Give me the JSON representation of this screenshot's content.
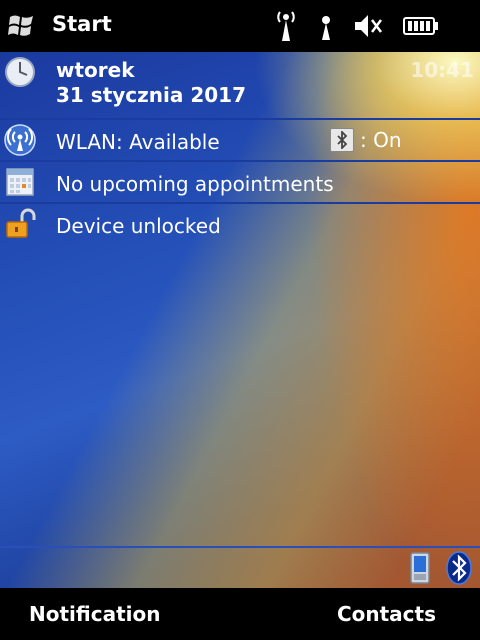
{
  "titlebar": {
    "title": "Start",
    "icons": [
      "windows-logo-icon",
      "wireless-antenna-icon",
      "signal-icon",
      "speaker-muted-icon",
      "battery-icon"
    ]
  },
  "today": {
    "day": "wtorek",
    "date": "31 stycznia 2017",
    "time": "10:41",
    "wlan": "WLAN: Available",
    "bluetooth": ": On",
    "appointments": "No upcoming appointments",
    "device": "Device unlocked"
  },
  "tray": {
    "icons": [
      "pda-icon",
      "bluetooth-icon"
    ]
  },
  "softkeys": {
    "left": "Notification",
    "right": "Contacts"
  },
  "colors": {
    "background_blue": "#2450b8",
    "row_line": "#1a3c9e",
    "accent_orange": "#e6781e"
  }
}
